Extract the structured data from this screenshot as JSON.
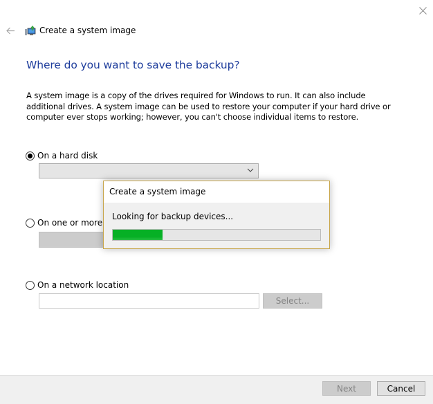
{
  "window": {
    "title": "Create a system image",
    "icons": {
      "back": "back-arrow-icon",
      "app": "system-image-backup-icon",
      "close": "close-icon"
    }
  },
  "main": {
    "heading": "Where do you want to save the backup?",
    "description": "A system image is a copy of the drives required for Windows to run. It can also include additional drives. A system image can be used to restore your computer if your hard drive or computer ever stops working; however, you can't choose individual items to restore.",
    "options": [
      {
        "label": "On a hard disk",
        "selected": true,
        "control": "dropdown",
        "value": ""
      },
      {
        "label": "On one or more DVDs",
        "visible_label": "On one or more D",
        "selected": false,
        "control": "dropdown",
        "value": ""
      },
      {
        "label": "On a network location",
        "selected": false,
        "control": "text-input",
        "value": "",
        "button_label": "Select..."
      }
    ]
  },
  "dialog": {
    "title": "Create a system image",
    "message": "Looking for backup devices...",
    "progress_percent": 24,
    "progress_color": "#06b025"
  },
  "footer": {
    "next_label": "Next",
    "next_enabled": false,
    "cancel_label": "Cancel"
  }
}
